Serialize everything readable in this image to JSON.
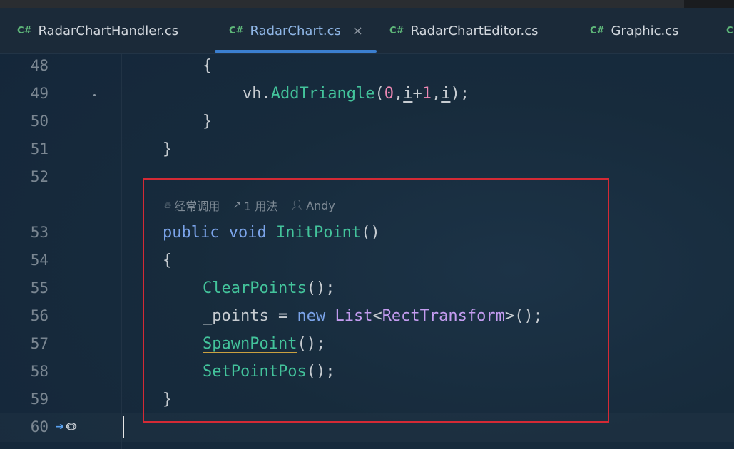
{
  "tabs": [
    {
      "badge": "C#",
      "label": "RadarChartHandler.cs"
    },
    {
      "badge": "C#",
      "label": "RadarChart.cs",
      "close": "×"
    },
    {
      "badge": "C#",
      "label": "RadarChartEditor.cs"
    },
    {
      "badge": "C#",
      "label": "Graphic.cs"
    },
    {
      "badge": "C"
    }
  ],
  "line_numbers": [
    "48",
    "49",
    "50",
    "51",
    "52",
    "53",
    "54",
    "55",
    "56",
    "57",
    "58",
    "59",
    "60"
  ],
  "code": {
    "l48": "{",
    "l49": {
      "obj": "vh",
      "dot": ".",
      "method": "AddTriangle",
      "open": "(",
      "n0": "0",
      "c1": ",",
      "i1": "i",
      "plus": "+",
      "n1": "1",
      "c2": ",",
      "i2": "i",
      "close": ");"
    },
    "l50": "}",
    "l51": "}",
    "l53": {
      "kw1": "public",
      "kw2": "void",
      "name": "InitPoint",
      "parens": "()"
    },
    "l54": "{",
    "l55": {
      "fn": "ClearPoints",
      "rest": "();"
    },
    "l56": {
      "var": "_points = ",
      "kw": "new",
      "ty1": "List",
      "lt": "<",
      "ty2": "RectTransform",
      "rest": ">();"
    },
    "l57": {
      "fn": "SpawnPoint",
      "rest": "();"
    },
    "l58": {
      "fn": "SetPointPos",
      "rest": "();"
    },
    "l59": "}"
  },
  "inlay_hints": {
    "frequent": "经常调用",
    "usages": "1 用法",
    "author": "Andy"
  },
  "colors": {
    "keyword": "#7ba4ea",
    "function": "#43c39b",
    "type": "#c49cf0",
    "number": "#ee88b4",
    "highlight_box": "#d42a35",
    "active_tab_underline": "#3b7fd0"
  }
}
